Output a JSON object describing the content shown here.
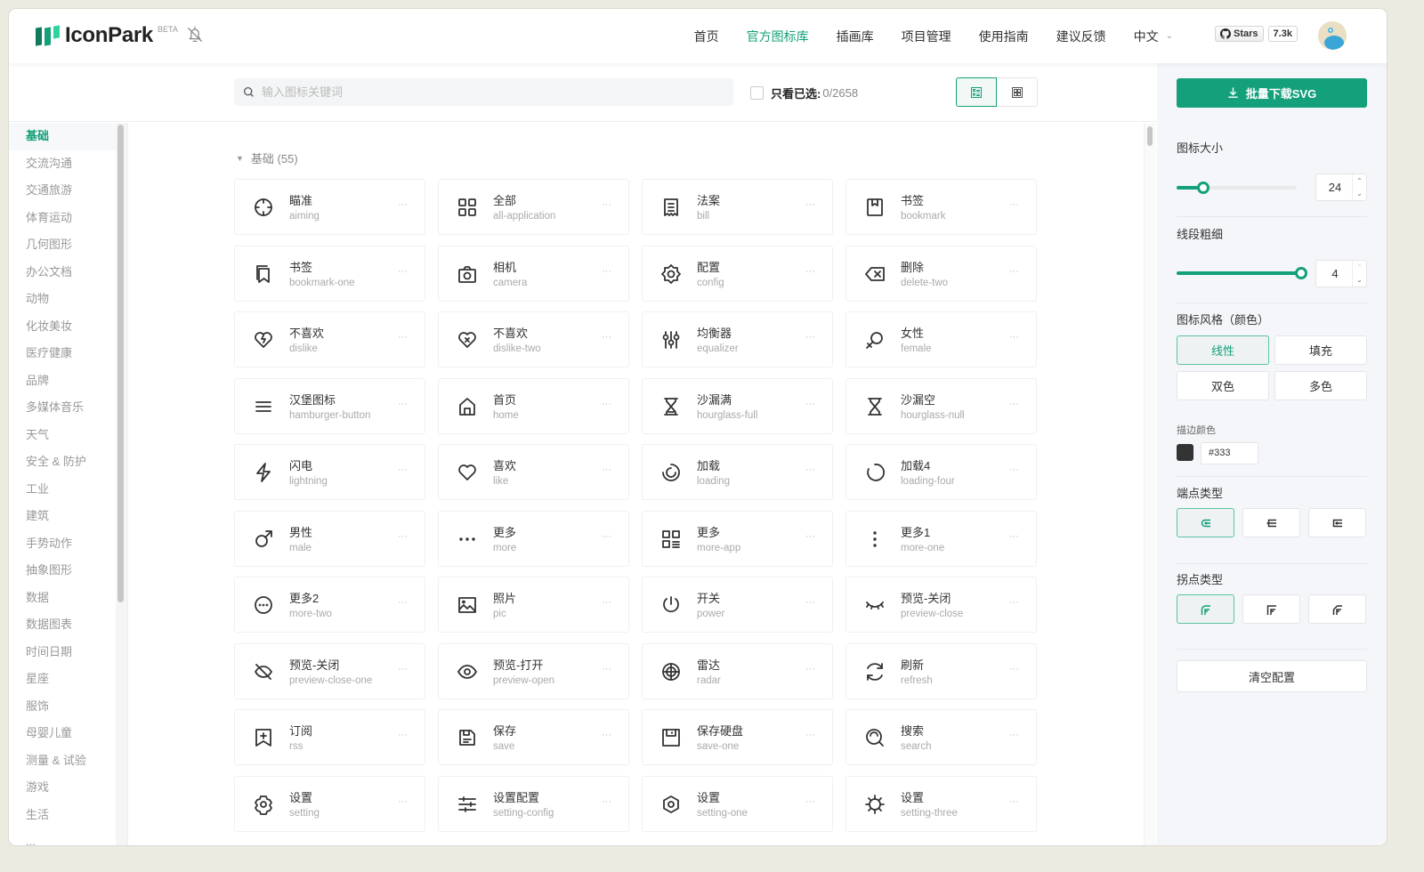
{
  "header": {
    "brand": "IconPark",
    "beta": "BETA",
    "nav": [
      {
        "label": "首页",
        "active": false
      },
      {
        "label": "官方图标库",
        "active": true
      },
      {
        "label": "插画库",
        "active": false
      },
      {
        "label": "项目管理",
        "active": false
      },
      {
        "label": "使用指南",
        "active": false
      },
      {
        "label": "建议反馈",
        "active": false
      }
    ],
    "language": "中文",
    "github_stars_label": "Stars",
    "github_stars_count": "7.3k"
  },
  "toolbar": {
    "search_placeholder": "输入图标关键词",
    "search_value": "",
    "only_selected_label": "只看已选:",
    "selected_count": "0/2658"
  },
  "sidebar": {
    "items": [
      {
        "label": "基础",
        "active": true
      },
      {
        "label": "交流沟通"
      },
      {
        "label": "交通旅游"
      },
      {
        "label": "体育运动"
      },
      {
        "label": "几何图形"
      },
      {
        "label": "办公文档"
      },
      {
        "label": "动物"
      },
      {
        "label": "化妆美妆"
      },
      {
        "label": "医疗健康"
      },
      {
        "label": "品牌"
      },
      {
        "label": "多媒体音乐"
      },
      {
        "label": "天气"
      },
      {
        "label": "安全 & 防护"
      },
      {
        "label": "工业"
      },
      {
        "label": "建筑"
      },
      {
        "label": "手势动作"
      },
      {
        "label": "抽象图形"
      },
      {
        "label": "数据"
      },
      {
        "label": "数据图表"
      },
      {
        "label": "时间日期"
      },
      {
        "label": "星座"
      },
      {
        "label": "服饰"
      },
      {
        "label": "母婴儿童"
      },
      {
        "label": "测量 & 试验"
      },
      {
        "label": "游戏"
      },
      {
        "label": "生活"
      },
      {
        "label": "..."
      }
    ]
  },
  "main": {
    "section_title": "基础 (55)",
    "more_glyph": "···",
    "icons": [
      {
        "cn": "瞄准",
        "en": "aiming",
        "icon": "aiming-icon"
      },
      {
        "cn": "全部",
        "en": "all-application",
        "icon": "all-application-icon"
      },
      {
        "cn": "法案",
        "en": "bill",
        "icon": "bill-icon"
      },
      {
        "cn": "书签",
        "en": "bookmark",
        "icon": "bookmark-icon"
      },
      {
        "cn": "书签",
        "en": "bookmark-one",
        "icon": "bookmark-one-icon"
      },
      {
        "cn": "相机",
        "en": "camera",
        "icon": "camera-icon"
      },
      {
        "cn": "配置",
        "en": "config",
        "icon": "config-icon"
      },
      {
        "cn": "删除",
        "en": "delete-two",
        "icon": "delete-two-icon"
      },
      {
        "cn": "不喜欢",
        "en": "dislike",
        "icon": "dislike-icon"
      },
      {
        "cn": "不喜欢",
        "en": "dislike-two",
        "icon": "dislike-two-icon"
      },
      {
        "cn": "均衡器",
        "en": "equalizer",
        "icon": "equalizer-icon"
      },
      {
        "cn": "女性",
        "en": "female",
        "icon": "female-icon"
      },
      {
        "cn": "汉堡图标",
        "en": "hamburger-button",
        "icon": "hamburger-button-icon"
      },
      {
        "cn": "首页",
        "en": "home",
        "icon": "home-icon"
      },
      {
        "cn": "沙漏满",
        "en": "hourglass-full",
        "icon": "hourglass-full-icon"
      },
      {
        "cn": "沙漏空",
        "en": "hourglass-null",
        "icon": "hourglass-null-icon"
      },
      {
        "cn": "闪电",
        "en": "lightning",
        "icon": "lightning-icon"
      },
      {
        "cn": "喜欢",
        "en": "like",
        "icon": "like-icon"
      },
      {
        "cn": "加载",
        "en": "loading",
        "icon": "loading-icon"
      },
      {
        "cn": "加载4",
        "en": "loading-four",
        "icon": "loading-four-icon"
      },
      {
        "cn": "男性",
        "en": "male",
        "icon": "male-icon"
      },
      {
        "cn": "更多",
        "en": "more",
        "icon": "more-icon"
      },
      {
        "cn": "更多",
        "en": "more-app",
        "icon": "more-app-icon"
      },
      {
        "cn": "更多1",
        "en": "more-one",
        "icon": "more-one-icon"
      },
      {
        "cn": "更多2",
        "en": "more-two",
        "icon": "more-two-icon"
      },
      {
        "cn": "照片",
        "en": "pic",
        "icon": "pic-icon"
      },
      {
        "cn": "开关",
        "en": "power",
        "icon": "power-icon"
      },
      {
        "cn": "预览-关闭",
        "en": "preview-close",
        "icon": "preview-close-icon"
      },
      {
        "cn": "预览-关闭",
        "en": "preview-close-one",
        "icon": "preview-close-one-icon"
      },
      {
        "cn": "预览-打开",
        "en": "preview-open",
        "icon": "preview-open-icon"
      },
      {
        "cn": "雷达",
        "en": "radar",
        "icon": "radar-icon"
      },
      {
        "cn": "刷新",
        "en": "refresh",
        "icon": "refresh-icon"
      },
      {
        "cn": "订阅",
        "en": "rss",
        "icon": "rss-icon"
      },
      {
        "cn": "保存",
        "en": "save",
        "icon": "save-icon"
      },
      {
        "cn": "保存硬盘",
        "en": "save-one",
        "icon": "save-one-icon"
      },
      {
        "cn": "搜索",
        "en": "search",
        "icon": "search-icon"
      },
      {
        "cn": "设置",
        "en": "setting",
        "icon": "setting-icon"
      },
      {
        "cn": "设置配置",
        "en": "setting-config",
        "icon": "setting-config-icon"
      },
      {
        "cn": "设置",
        "en": "setting-one",
        "icon": "setting-one-icon"
      },
      {
        "cn": "设置",
        "en": "setting-three",
        "icon": "setting-three-icon"
      }
    ]
  },
  "panel": {
    "download_label": "批量下载SVG",
    "size_label": "图标大小",
    "size_value": "24",
    "size_fraction": 0.22,
    "stroke_label": "线段粗细",
    "stroke_value": "4",
    "stroke_fraction": 1.0,
    "style_label": "图标风格（颜色）",
    "styles": [
      {
        "label": "线性",
        "active": true
      },
      {
        "label": "填充",
        "active": false
      },
      {
        "label": "双色",
        "active": false
      },
      {
        "label": "多色",
        "active": false
      }
    ],
    "stroke_color_label": "描边颜色",
    "stroke_color": "#333",
    "linecap_label": "端点类型",
    "linejoin_label": "拐点类型",
    "clear_label": "清空配置"
  },
  "colors": {
    "brand": "#13a07a",
    "text": "#333333",
    "muted": "#999999",
    "panel_bg": "#f4f6f9"
  }
}
